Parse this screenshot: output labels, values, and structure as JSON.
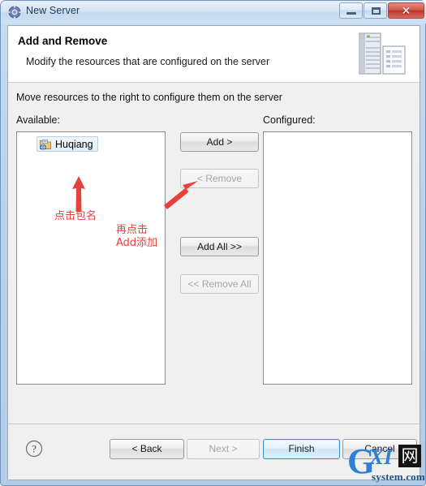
{
  "window": {
    "title": "New Server",
    "title_icon": "server-wizard-icon",
    "controls": {
      "minimize": "minimize-icon",
      "maximize": "restore-icon",
      "close": "close-icon",
      "close_glyph": "✕"
    }
  },
  "header": {
    "title": "Add and Remove",
    "description": "Modify the resources that are configured on the server",
    "icon": "server-and-document-icon"
  },
  "main": {
    "instruction": "Move resources to the right to configure them on the server",
    "available_label": "Available:",
    "configured_label": "Configured:",
    "available_items": [
      {
        "label": "Huqiang",
        "icon": "web-project-icon",
        "selected": true
      }
    ],
    "configured_items": []
  },
  "transfer_buttons": [
    {
      "label": "Add >",
      "name": "add-button",
      "enabled": true
    },
    {
      "label": "< Remove",
      "name": "remove-button",
      "enabled": false
    },
    {
      "label": "Add All >>",
      "name": "add-all-button",
      "enabled": true
    },
    {
      "label": "<< Remove All",
      "name": "remove-all-button",
      "enabled": false
    }
  ],
  "annotations": [
    {
      "text": "点击包名",
      "color": "#e8413a"
    },
    {
      "text": "再点击",
      "color": "#e8413a"
    },
    {
      "text": "Add添加",
      "color": "#e8413a"
    }
  ],
  "footer": {
    "help_icon": "help-question-icon",
    "buttons": [
      {
        "label": "< Back",
        "name": "back-button",
        "enabled": true,
        "primary": false
      },
      {
        "label": "Next >",
        "name": "next-button",
        "enabled": false,
        "primary": false
      },
      {
        "label": "Finish",
        "name": "finish-button",
        "enabled": true,
        "primary": true
      },
      {
        "label": "Cancel",
        "name": "cancel-button",
        "enabled": true,
        "primary": false
      }
    ]
  },
  "watermark": {
    "g": "G",
    "xi": "XI",
    "cjk": "网",
    "sub": "system.com"
  }
}
